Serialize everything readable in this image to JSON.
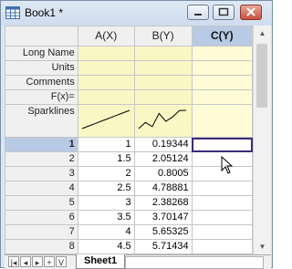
{
  "window": {
    "title": "Book1 *"
  },
  "columns": [
    {
      "label": "A(X)",
      "selected": false
    },
    {
      "label": "B(Y)",
      "selected": false
    },
    {
      "label": "C(Y)",
      "selected": true
    }
  ],
  "meta_rows": [
    "Long Name",
    "Units",
    "Comments",
    "F(x)="
  ],
  "sparkline_label": "Sparklines",
  "rows": [
    {
      "n": "1",
      "a": "1",
      "b": "0.19344"
    },
    {
      "n": "2",
      "a": "1.5",
      "b": "2.05124"
    },
    {
      "n": "3",
      "a": "2",
      "b": "0.8005"
    },
    {
      "n": "4",
      "a": "2.5",
      "b": "4.78881"
    },
    {
      "n": "5",
      "a": "3",
      "b": "2.38268"
    },
    {
      "n": "6",
      "a": "3.5",
      "b": "3.70147"
    },
    {
      "n": "7",
      "a": "4",
      "b": "5.65325"
    },
    {
      "n": "8",
      "a": "4.5",
      "b": "5.71434"
    }
  ],
  "tabs": {
    "sheet_name": "Sheet1",
    "nav_plus": "+",
    "nav_menu": "V"
  },
  "colors": {
    "meta_bg": "#fbf7c5",
    "selected_header": "#b9cbe4",
    "active_border": "#3a2a7a"
  }
}
